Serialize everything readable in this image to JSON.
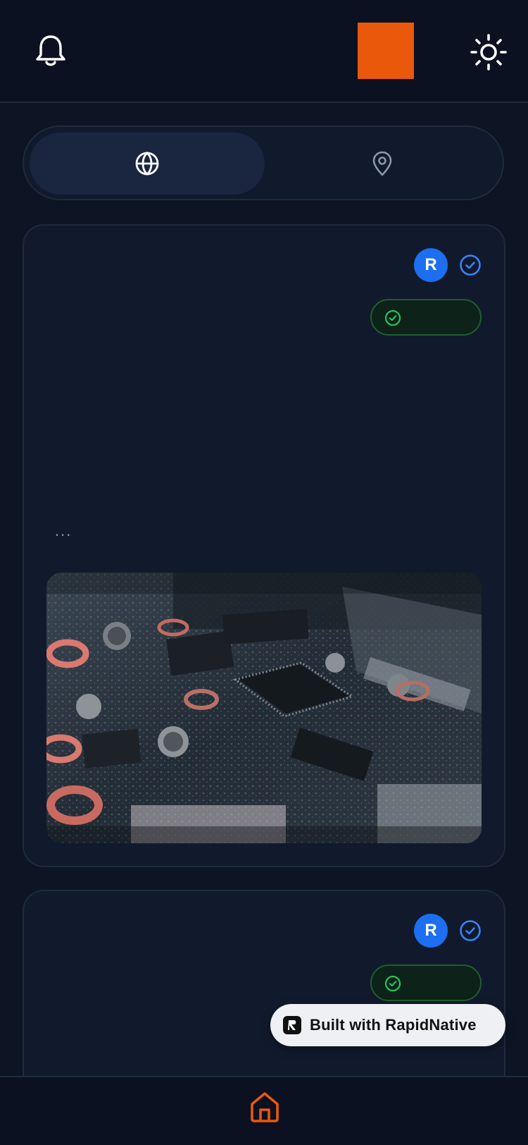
{
  "header": {
    "notifications_icon": "bell-icon",
    "theme_icon": "sun-icon",
    "brand_color": "#ea580c"
  },
  "segments": [
    {
      "icon": "globe-icon",
      "active": true
    },
    {
      "icon": "map-pin-icon",
      "active": false
    }
  ],
  "posts": [
    {
      "avatar_initial": "R",
      "verified_icon": "check-circle-icon",
      "status_icon": "check-circle-icon",
      "status_text": "",
      "more": "...",
      "image": "circuit-board-photo"
    },
    {
      "avatar_initial": "R",
      "verified_icon": "check-circle-icon",
      "status_icon": "check-circle-icon",
      "status_text": ""
    }
  ],
  "badge": {
    "label": "Built with RapidNative"
  },
  "tabbar": {
    "home_icon": "home-icon",
    "accent_color": "#ea580c"
  }
}
